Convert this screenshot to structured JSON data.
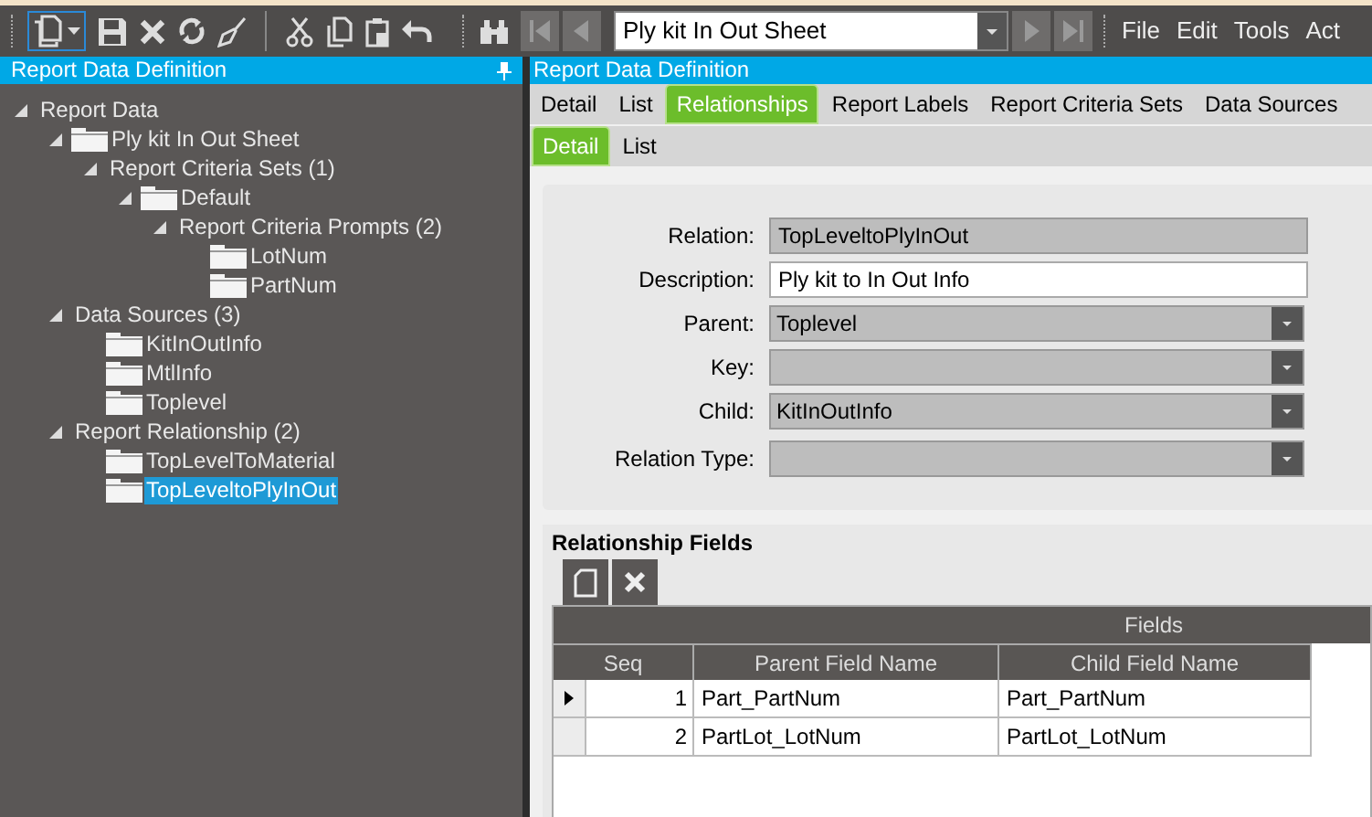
{
  "toolbar": {
    "record_field": {
      "value": "Ply kit In Out Sheet"
    },
    "menu": [
      "File",
      "Edit",
      "Tools",
      "Act"
    ]
  },
  "left_panel": {
    "title": "Report Data Definition",
    "tree": [
      {
        "label": "Report Data",
        "kind": "group",
        "expanded": true,
        "selected": false,
        "children": [
          {
            "label": "Ply kit In Out Sheet",
            "kind": "folder",
            "expanded": true,
            "selected": false,
            "children": [
              {
                "label": "Report Criteria Sets (1)",
                "kind": "group",
                "expanded": true,
                "selected": false,
                "children": [
                  {
                    "label": "Default",
                    "kind": "folder",
                    "expanded": true,
                    "selected": false,
                    "children": [
                      {
                        "label": "Report Criteria Prompts (2)",
                        "kind": "group",
                        "expanded": true,
                        "selected": false,
                        "children": [
                          {
                            "label": "LotNum",
                            "kind": "folder",
                            "selected": false
                          },
                          {
                            "label": "PartNum",
                            "kind": "folder",
                            "selected": false
                          }
                        ]
                      }
                    ]
                  }
                ]
              }
            ]
          },
          {
            "label": "Data Sources (3)",
            "kind": "group",
            "expanded": true,
            "selected": false,
            "children": [
              {
                "label": "KitInOutInfo",
                "kind": "folder",
                "selected": false
              },
              {
                "label": "MtlInfo",
                "kind": "folder",
                "selected": false
              },
              {
                "label": "Toplevel",
                "kind": "folder",
                "selected": false
              }
            ]
          },
          {
            "label": "Report Relationship (2)",
            "kind": "group",
            "expanded": true,
            "selected": false,
            "children": [
              {
                "label": "TopLevelToMaterial",
                "kind": "folder",
                "selected": false
              },
              {
                "label": "TopLeveltoPlyInOut",
                "kind": "folder",
                "selected": true
              }
            ]
          }
        ]
      }
    ]
  },
  "right_panel": {
    "title": "Report Data Definition",
    "tabs": [
      {
        "label": "Detail",
        "selected": false
      },
      {
        "label": "List",
        "selected": false
      },
      {
        "label": "Relationships",
        "selected": true
      },
      {
        "label": "Report Labels",
        "selected": false
      },
      {
        "label": "Report Criteria Sets",
        "selected": false
      },
      {
        "label": "Data Sources",
        "selected": false
      }
    ],
    "subtabs": [
      {
        "label": "Detail",
        "selected": true
      },
      {
        "label": "List",
        "selected": false
      }
    ],
    "fields": [
      {
        "label": "Relation:",
        "kind": "readonly",
        "value": "TopLeveltoPlyInOut"
      },
      {
        "label": "Description:",
        "kind": "text",
        "value": "Ply kit to In Out Info"
      },
      {
        "label": "Parent:",
        "kind": "dropdown",
        "value": "Toplevel"
      },
      {
        "label": "Key:",
        "kind": "dropdown"
      },
      {
        "label": "Child:",
        "kind": "dropdown",
        "value": "KitInOutInfo"
      },
      {
        "label": "Relation Type:",
        "kind": "dropdown"
      }
    ],
    "relationship_fields": {
      "title": "Relationship Fields",
      "band": "Fields",
      "columns": [
        "Seq",
        "Parent Field Name",
        "Child Field Name"
      ],
      "rows": [
        {
          "selected": true,
          "cells": [
            "1",
            "Part_PartNum",
            "Part_PartNum"
          ]
        },
        {
          "selected": false,
          "cells": [
            "2",
            "PartLot_LotNum",
            "PartLot_LotNum"
          ]
        }
      ]
    }
  }
}
